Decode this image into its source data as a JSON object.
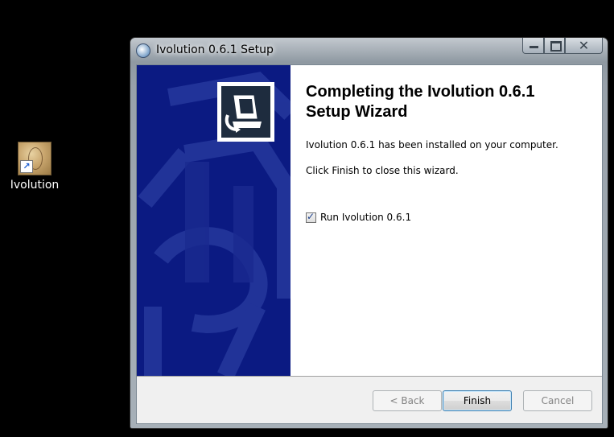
{
  "desktop": {
    "icon_label": "Ivolution"
  },
  "window": {
    "title": "Ivolution 0.6.1 Setup",
    "caption": {
      "minimize": "",
      "maximize": "",
      "close": "✕"
    }
  },
  "wizard": {
    "heading": "Completing the Ivolution 0.6.1 Setup Wizard",
    "text_installed": "Ivolution 0.6.1 has been installed on your computer.",
    "text_close": "Click Finish to close this wizard.",
    "checkbox_label": "Run Ivolution 0.6.1",
    "checkbox_checked": true,
    "checkbox_mark": "✓"
  },
  "buttons": {
    "back": "< Back",
    "finish": "Finish",
    "cancel": "Cancel"
  },
  "colors": {
    "sidebar": "#0b1a82",
    "sidebar_pattern": "#2a3c9e"
  }
}
